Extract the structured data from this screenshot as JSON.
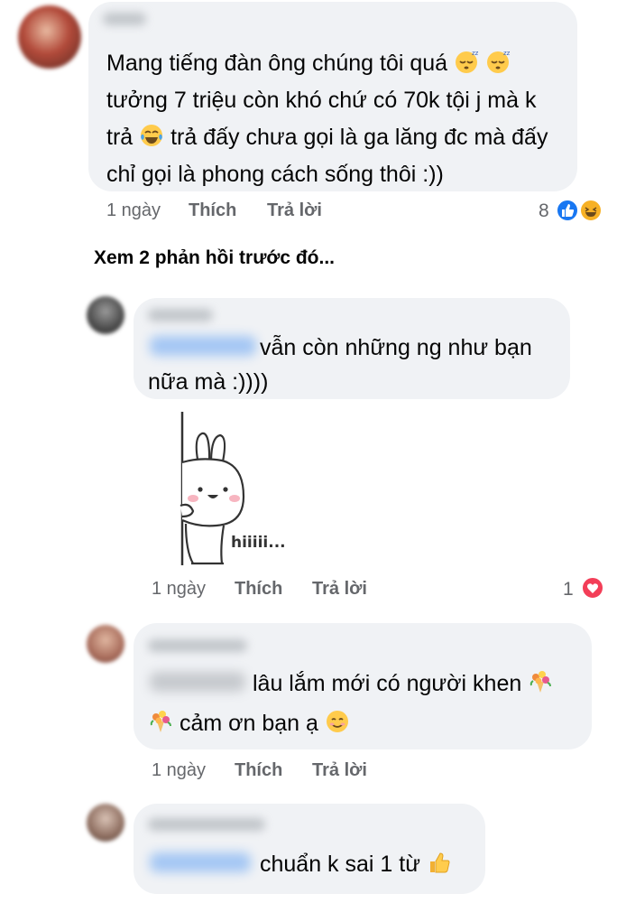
{
  "comments": [
    {
      "lines": [
        "Mang tiếng đàn ông chúng tôi quá",
        "tưởng 7 triệu còn khó chứ có 70k tội j mà k",
        "trả",
        "trả đấy chưa gọi là ga lăng đc mà đấy",
        "chỉ gọi là phong cách sống thôi :))"
      ],
      "time": "1 ngày",
      "like": "Thích",
      "reply": "Trả lời",
      "reaction_count": "8"
    },
    {
      "lines": [
        "vẫn còn những ng như bạn",
        "nữa mà :))))"
      ],
      "sticker_text": "hiiiii...",
      "time": "1 ngày",
      "like": "Thích",
      "reply": "Trả lời",
      "reaction_count": "1"
    },
    {
      "lines": [
        "lâu lắm mới có người khen",
        "cảm ơn bạn ạ"
      ],
      "time": "1 ngày",
      "like": "Thích",
      "reply": "Trả lời"
    },
    {
      "lines": [
        "chuẩn k sai 1 từ"
      ]
    }
  ],
  "see_more": "Xem 2 phản hồi trước đó...",
  "colors": {
    "bubble": "#f0f2f5",
    "like_blue": "#1877f2",
    "love_red": "#f33e58",
    "haha_yellow": "#f7b125",
    "meta_gray": "#65676b"
  },
  "icons": {
    "sleepy": "sleepy-face-icon",
    "laugh": "tears-of-joy-icon",
    "bouquet": "bouquet-icon",
    "smile": "smiling-face-icon",
    "thumbs": "thumbs-up-icon",
    "like": "like-reaction-icon",
    "haha": "haha-reaction-icon",
    "love": "love-reaction-icon"
  }
}
